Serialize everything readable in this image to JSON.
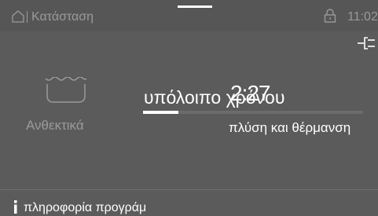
{
  "header": {
    "title": "Κατάσταση",
    "time": "11:02"
  },
  "program": {
    "name": "Ανθεκτικά",
    "icon": "washtub-icon"
  },
  "status": {
    "remaining_label": "υπόλοιπο χρόνου",
    "remaining_time": "2:27",
    "phase": "πλύση και θέρμανση",
    "progress_fraction": 0.16
  },
  "footer": {
    "info_label": "πληροφορία προγράμ"
  },
  "colors": {
    "background": "#5b5b5b",
    "dim_text": "#9a9a9a",
    "text": "#ffffff",
    "track": "#6c6c6c"
  }
}
